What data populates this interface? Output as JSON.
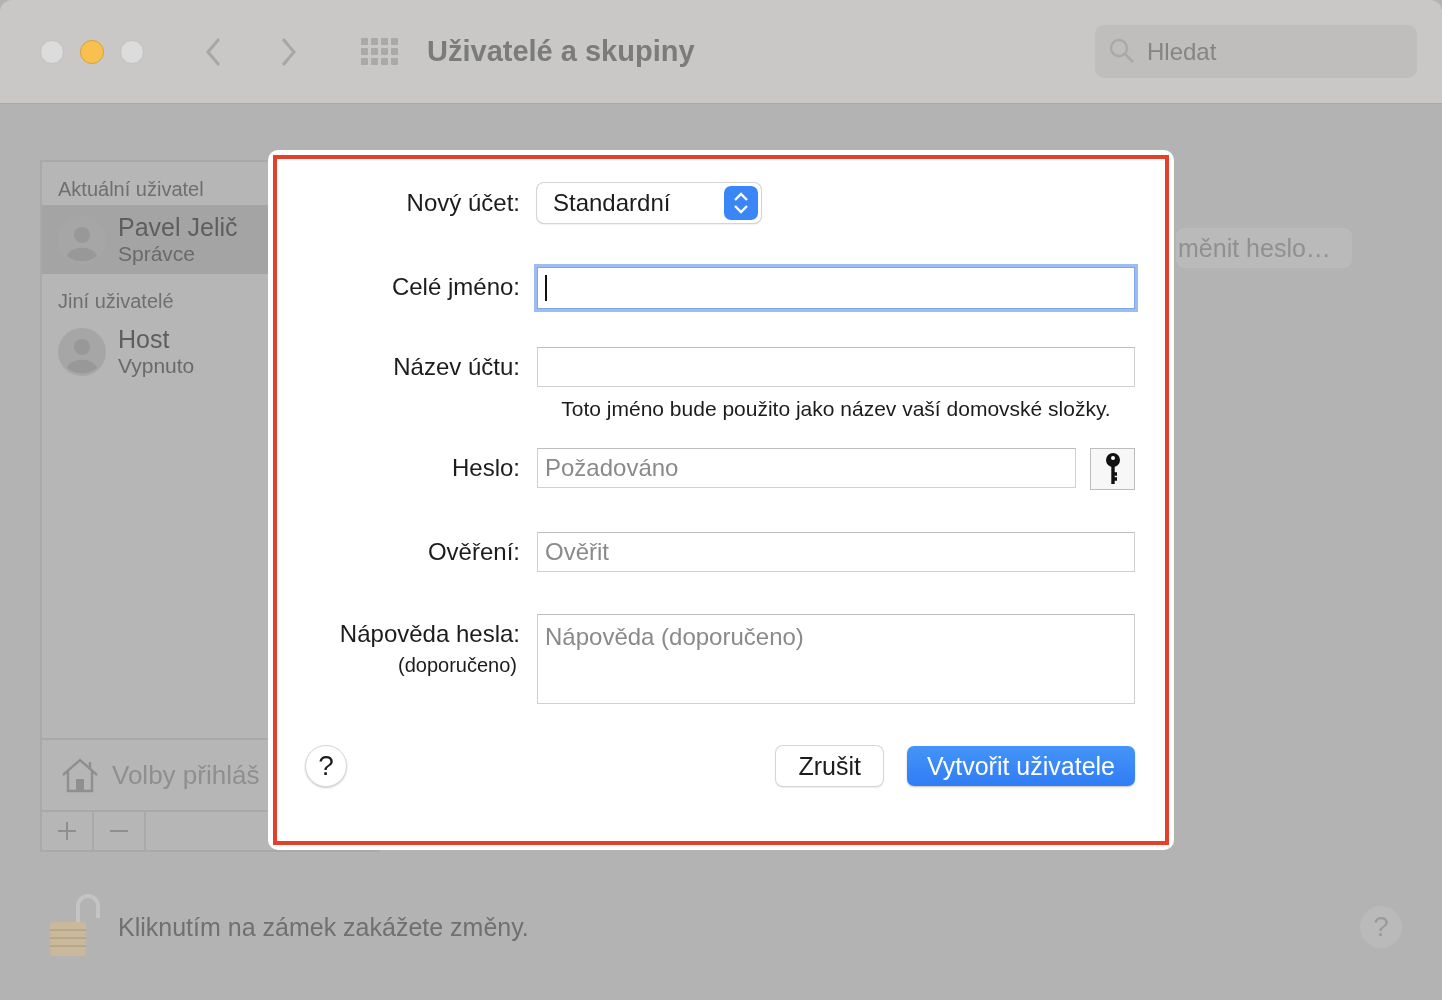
{
  "window": {
    "title": "Uživatelé a skupiny",
    "search": {
      "placeholder": "Hledat"
    }
  },
  "sidebar": {
    "sections": [
      {
        "heading": "Aktuální uživatel",
        "users": [
          {
            "name": "Pavel Jelič",
            "role": "Správce",
            "selected": true
          }
        ]
      },
      {
        "heading": "Jiní uživatelé",
        "users": [
          {
            "name": "Host",
            "role": "Vypnuto",
            "selected": false
          }
        ]
      }
    ],
    "login_options": "Volby přihláš"
  },
  "change_password_button": "měnit heslo…",
  "lock_message": "Kliknutím na zámek zakážete změny.",
  "help_button": "?",
  "dialog": {
    "fields": [
      {
        "kind": "popup",
        "label": "Nový účet:",
        "value": "Standardní"
      },
      {
        "kind": "text",
        "label": "Celé jméno:",
        "focused": true
      },
      {
        "kind": "text",
        "label": "Název účtu:",
        "focused": false,
        "note": "Toto jméno bude použito jako název vaší domovské složky."
      },
      {
        "kind": "password",
        "label": "Heslo:",
        "placeholder": "Požadováno"
      },
      {
        "kind": "text",
        "label": "Ověření:",
        "placeholder": "Ověřit",
        "focused": false
      },
      {
        "kind": "textarea",
        "label": "Nápověda hesla:",
        "sublabel": "(doporučeno)",
        "placeholder": "Nápověda (doporučeno)"
      }
    ],
    "help_button": "?",
    "buttons": [
      {
        "label": "Zrušit",
        "default": false
      },
      {
        "label": "Vytvořit uživatele",
        "default": true
      }
    ]
  }
}
